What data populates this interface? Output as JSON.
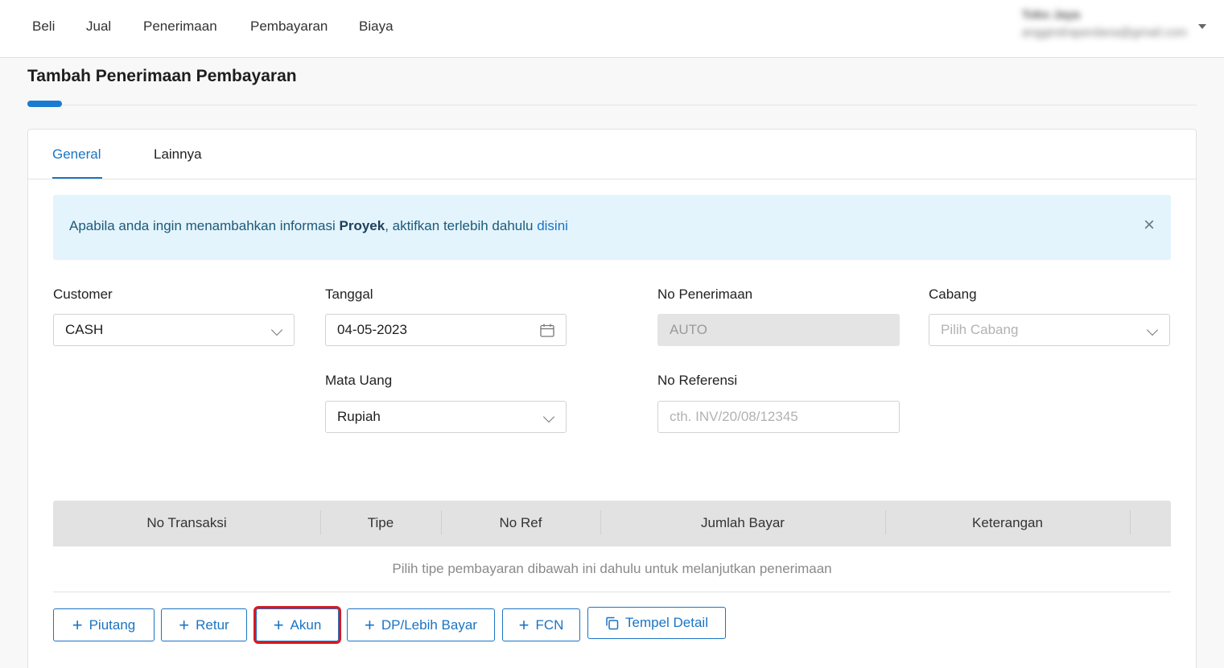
{
  "nav": {
    "items": [
      "Beli",
      "Jual",
      "Penerimaan",
      "Pembayaran",
      "Biaya"
    ]
  },
  "user": {
    "name": "Toko Jaya",
    "email": "anggindraperdana@gmail.com"
  },
  "page": {
    "title": "Tambah Penerimaan Pembayaran"
  },
  "tabs": {
    "general": "General",
    "lainnya": "Lainnya",
    "active": "General"
  },
  "alert": {
    "text_before": "Apabila anda ingin menambahkan informasi ",
    "bold": "Proyek",
    "text_after": ", aktifkan terlebih dahulu ",
    "link": "disini",
    "close": "×"
  },
  "form": {
    "customer": {
      "label": "Customer",
      "value": "CASH"
    },
    "tanggal": {
      "label": "Tanggal",
      "value": "04-05-2023"
    },
    "no_penerimaan": {
      "label": "No Penerimaan",
      "value": "AUTO"
    },
    "cabang": {
      "label": "Cabang",
      "placeholder": "Pilih Cabang"
    },
    "mata_uang": {
      "label": "Mata Uang",
      "value": "Rupiah"
    },
    "no_referensi": {
      "label": "No Referensi",
      "placeholder": "cth. INV/20/08/12345"
    }
  },
  "table": {
    "columns": [
      "No Transaksi",
      "Tipe",
      "No Ref",
      "Jumlah Bayar",
      "Keterangan"
    ],
    "empty_message": "Pilih tipe pembayaran dibawah ini dahulu untuk melanjutkan penerimaan"
  },
  "buttons": {
    "piutang": "Piutang",
    "retur": "Retur",
    "akun": "Akun",
    "dp": "DP/Lebih Bayar",
    "fcn": "FCN",
    "tempel": "Tempel Detail",
    "highlighted": "Akun"
  },
  "colors": {
    "accent": "#1a74c4",
    "highlight_border": "#d71920",
    "alert_bg": "#e3f4fc"
  }
}
